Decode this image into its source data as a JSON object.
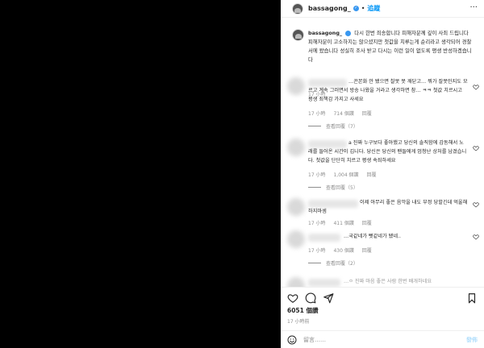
{
  "post": {
    "username": "bassagong_",
    "follow_label": "追蹤",
    "dot": "•",
    "caption_text": "다시 한번 죄송합니다 피해자분께 깊이 사죄 드립니다 피해자분이 고소하지는 않으셨지만 첫값을 치루는게 순리라고 생각되어 경찰서에 왔습니다 성실히 조사 받고 다시는 이런 일이 없도록 평생 반성하겠습니다",
    "caption_time": "17 小時",
    "likes": "6051 個讚",
    "post_time": "17 小時前"
  },
  "comments": [
    {
      "text": "…끈본화 안 됐으면 찰못 못 깨닫고… 뭐가 잘못인지도 모르고 계속 그러면서 방송 나왔을 거라고 생각하면 참… ㅋㅋ 첫값 치르시고 평생 죄책감 가지고 사세요",
      "time": "17 小時",
      "likes": "714 個讚",
      "reply": "回覆",
      "replies": "查看回覆（7）"
    },
    {
      "text": "a 진짜 누구보다 좋아했고 당신의 솔직함에 감동해서 노래를 들어온 시간이 깁니다. 당신은 당신의 팬들에게 엄청난 상처를 남겼습니다. 첫값을 단단히 치르고 평생 속죄하세요",
      "time": "17 小時",
      "likes": "1,004 個讚",
      "reply": "回覆",
      "replies": "查看回覆（5）"
    },
    {
      "text": "이제 아무리 좋은 음악을 내도 부정 당할긴데 억울해 하지마셈",
      "time": "17 小時",
      "likes": "411 個讚",
      "reply": "回覆",
      "replies": ""
    },
    {
      "text": "…국같네가 뻣같네가 됐네..",
      "time": "17 小時",
      "likes": "430 個讚",
      "reply": "回覆",
      "replies": "查看回覆（2）"
    },
    {
      "text": "…ㅇ 진짜 마음 좋은 사람 한번 배개하네요",
      "time": "",
      "likes": "",
      "reply": "",
      "replies": ""
    }
  ],
  "composer": {
    "placeholder": "留言……",
    "post_label": "發佈"
  },
  "icons": {
    "heart": "heart-icon",
    "comment": "comment-icon",
    "share": "paper-plane-icon",
    "save": "bookmark-icon",
    "emoji": "smiley-icon",
    "more": "more-options-icon"
  },
  "colors": {
    "accent": "#0095f6",
    "verified": "#3897f0",
    "muted": "#8e8e8e"
  }
}
